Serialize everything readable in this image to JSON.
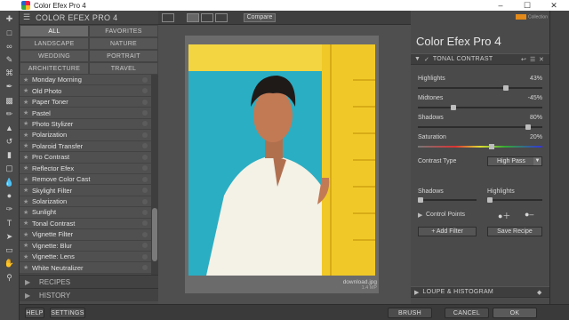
{
  "window": {
    "title": "Color Efex Pro 4"
  },
  "tools": [
    "move-icon",
    "marquee-icon",
    "lasso-icon",
    "quick-select-icon",
    "crop-icon",
    "eyedropper-icon",
    "heal-icon",
    "brush-icon",
    "stamp-icon",
    "history-brush-icon",
    "eraser-icon",
    "gradient-icon",
    "blur-icon",
    "dodge-icon",
    "pen-icon",
    "type-icon",
    "path-select-icon",
    "shape-icon",
    "hand-icon",
    "zoom-icon"
  ],
  "filter_panel": {
    "title": "COLOR EFEX PRO 4",
    "categories": [
      {
        "label": "ALL",
        "active": true
      },
      {
        "label": "FAVORITES"
      },
      {
        "label": "LANDSCAPE"
      },
      {
        "label": "NATURE"
      },
      {
        "label": "WEDDING"
      },
      {
        "label": "PORTRAIT"
      },
      {
        "label": "ARCHITECTURE"
      },
      {
        "label": "TRAVEL"
      }
    ],
    "filters": [
      "Monday Morning",
      "Old Photo",
      "Paper Toner",
      "Pastel",
      "Photo Stylizer",
      "Polarization",
      "Polaroid Transfer",
      "Pro Contrast",
      "Reflector Efex",
      "Remove Color Cast",
      "Skylight Filter",
      "Solarization",
      "Sunlight",
      "Tonal Contrast",
      "Vignette Filter",
      "Vignette: Blur",
      "Vignette: Lens",
      "White Neutralizer"
    ],
    "recipes_label": "RECIPES",
    "history_label": "HISTORY"
  },
  "bottom": {
    "help": "HELP",
    "settings": "SETTINGS",
    "brush": "BRUSH",
    "cancel": "CANCEL",
    "ok": "OK"
  },
  "preview": {
    "compare_label": "Compare",
    "filename": "download.jpg",
    "size": "1.4 MP"
  },
  "right_panel": {
    "brand_sub": "Collection",
    "app_name": "Color Efex Pro",
    "app_version": "4",
    "section": "TONAL CONTRAST",
    "params": [
      {
        "label": "Highlights",
        "value": "43%",
        "pct": 0.715
      },
      {
        "label": "Midtones",
        "value": "-45%",
        "pct": 0.275
      },
      {
        "label": "Shadows",
        "value": "80%",
        "pct": 0.9
      },
      {
        "label": "Saturation",
        "value": "20%",
        "pct": 0.6
      }
    ],
    "contrast_type_label": "Contrast Type",
    "contrast_type_value": "High Pass",
    "shadows_label": "Shadows",
    "highlights_label": "Highlights",
    "control_points_label": "Control Points",
    "add_filter": "Add Filter",
    "save_recipe": "Save Recipe",
    "loupe_label": "LOUPE & HISTOGRAM"
  },
  "colors": {
    "accent": "#e38a1a",
    "panel": "#4a4a4a",
    "wall": "#2aaec3",
    "door": "#f2cf2c"
  }
}
